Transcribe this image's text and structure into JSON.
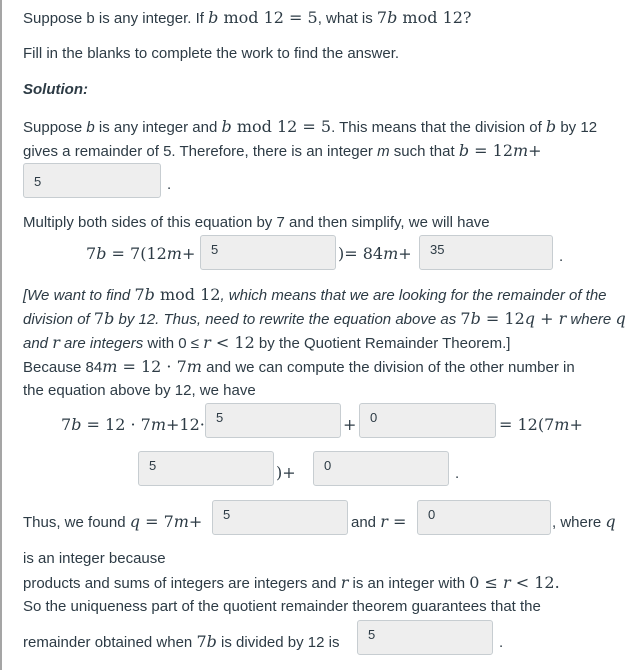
{
  "question": {
    "p1_a": "Suppose b is any integer. If ",
    "p1_b": "b",
    "p1_c": " mod 12 = 5",
    "p1_d": ", what is ",
    "p1_e": "7",
    "p1_f": "b",
    "p1_g": " mod 12",
    "p1_h": "?",
    "instructions": "Fill in the blanks to complete the work to find the answer.",
    "solution_label": "Solution:"
  },
  "step1": {
    "t1": "Suppose ",
    "b": "b",
    "t2": " is any integer and ",
    "m1": " mod 12 = 5",
    "t3": ". This means that the division of ",
    "t4": " by 12",
    "t5": "gives a remainder of 5. Therefore, there is an integer ",
    "mvar": "m",
    "t6": " such that ",
    "eq": " = 12",
    "plus": "+",
    "blank1": "5",
    "period": "."
  },
  "step2": {
    "intro": "Multiply both sides of this equation by 7 and then simplify, we will have",
    "lhs": "7",
    "eq1": " = 7(12",
    "plus": "+",
    "blank1": "5",
    "close": ")= 84",
    "blank2": "35",
    "period": "."
  },
  "step3": {
    "l1_a": "[We want to find ",
    "l1_b": " mod 12",
    "l1_c": ", which means that we are looking for the remainder of the",
    "l2_a": "division of ",
    "l2_b": " by 12. Thus, need to rewrite the equation above as ",
    "l2_c": " = 12",
    "l2_q": "q",
    "l2_d": " + ",
    "l2_r": "r",
    "l2_e": " where ",
    "l3_a": "and ",
    "l3_b": " are integers",
    "l3_c": " with 0 ≤ ",
    "l3_d": " < 12",
    "l3_e": " by the Quotient Remainder Theorem.]",
    "l4_a": "Because 84",
    "l4_b": " = 12 · 7",
    "l4_c": " and we can compute the division of the other number in",
    "l5": "the equation above by 12, we have"
  },
  "step4": {
    "lhs": " = 12 · 7",
    "plus12dot": "+12·",
    "blank1": "5",
    "plus": "+",
    "blank2": "0",
    "rhs": "= 12(7",
    "blank3": "5",
    "close": ")+",
    "blank4": "0",
    "period": "."
  },
  "step5": {
    "t1": "Thus, we found ",
    "q": "q",
    "t2": " = 7",
    "blank1": "5",
    "t3": "and ",
    "r": "r",
    "t4": " =",
    "blank2": "0",
    "t5": ", where ",
    "l2": "is an integer because",
    "l3_a": "products and sums of integers are integers and ",
    "l3_b": " is an integer with ",
    "l3_c": "0 ≤ ",
    "l3_d": " < 12.",
    "l4": "So the uniqueness part of the quotient remainder theorem guarantees that the",
    "l5_a": "remainder obtained when ",
    "l5_b": " is divided by 12 is",
    "blank3": "5",
    "period": "."
  }
}
